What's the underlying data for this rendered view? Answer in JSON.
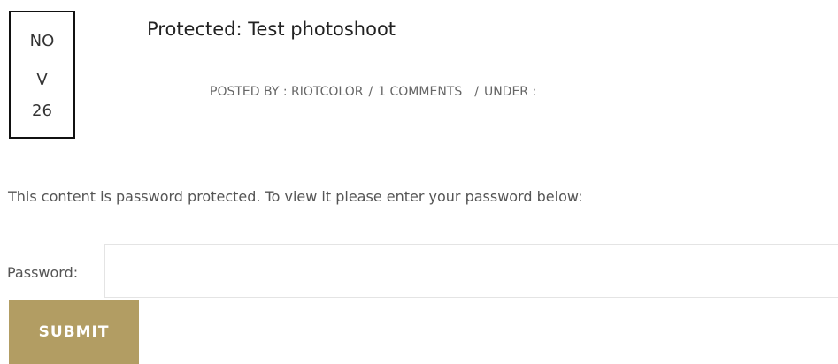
{
  "post": {
    "date": {
      "month_line1": "NO",
      "month_line2": "V",
      "day": "26"
    },
    "title": "Protected: Test photoshoot",
    "meta": {
      "posted_by_label": "POSTED BY : RIOTCOLOR",
      "comments": "1 COMMENTS",
      "under_label": "UNDER :",
      "separator": "/"
    }
  },
  "password_form": {
    "message": "This content is password protected. To view it please enter your password below:",
    "password_label": "Password:",
    "password_value": "",
    "submit_label": "SUBMIT",
    "submit_color": "#b29d63"
  }
}
